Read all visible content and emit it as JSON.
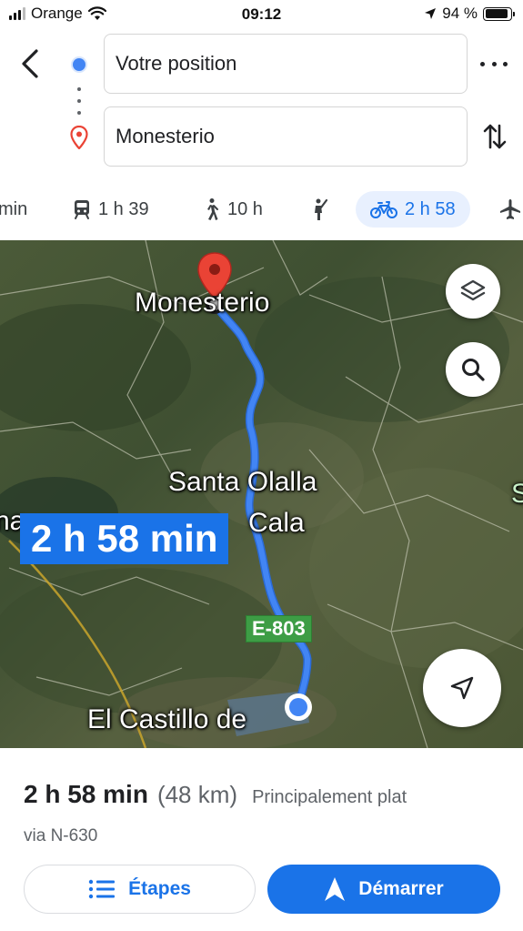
{
  "status_bar": {
    "carrier": "Orange",
    "time": "09:12",
    "battery": "94 %"
  },
  "directions": {
    "origin_value": "Votre position",
    "destination_value": "Monesterio"
  },
  "modes": [
    {
      "icon": "car-icon",
      "label": "min"
    },
    {
      "icon": "train-icon",
      "label": "1 h 39"
    },
    {
      "icon": "walking-icon",
      "label": "10 h"
    },
    {
      "icon": "ride-hailing-icon",
      "label": ""
    },
    {
      "icon": "bicycle-icon",
      "label": "2 h 58",
      "active": true
    },
    {
      "icon": "plane-icon",
      "label": ""
    }
  ],
  "map": {
    "labels": {
      "destination": "Monesterio",
      "town_1_line1": "Santa Olalla",
      "town_1_line2": "Cala",
      "town_2": "El Castillo de",
      "left_edge": "na",
      "right_edge": "S"
    },
    "duration_badge": "2 h 58 min",
    "road_shield": "E-803",
    "colors": {
      "route": "#4285f4",
      "badge": "#1a73e8",
      "shield": "#3d9d45",
      "pin": "#ea4335"
    }
  },
  "summary": {
    "duration": "2 h 58 min",
    "distance": "(48 km)",
    "terrain": "Principalement plat",
    "via": "via N-630"
  },
  "buttons": {
    "steps_label": "Étapes",
    "start_label": "Démarrer"
  }
}
